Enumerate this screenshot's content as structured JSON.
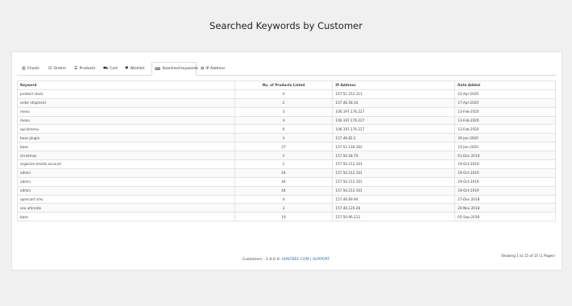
{
  "title": "Searched Keywords by Customer",
  "tabs": [
    {
      "label": "Charts",
      "icon": "bar-chart-icon",
      "glyph": "▥"
    },
    {
      "label": "Orders",
      "icon": "check-square-icon",
      "glyph": "☑"
    },
    {
      "label": "Products",
      "icon": "list-icon",
      "glyph": "☰"
    },
    {
      "label": "Cart",
      "icon": "cart-icon",
      "glyph": "⛟"
    },
    {
      "label": "Wishlist",
      "icon": "heart-icon",
      "glyph": "♥"
    },
    {
      "label": "Searched keywords",
      "icon": "keyboard-icon",
      "glyph": "⌨"
    },
    {
      "label": "IP Address",
      "icon": "globe-icon",
      "glyph": "◍"
    }
  ],
  "table": {
    "headers": [
      "Keyword",
      "No. of Products Listed",
      "IP Address",
      "Date Added"
    ],
    "rows": [
      [
        "product stock",
        "4",
        "157.51.252.111",
        "22-Apr-2020"
      ],
      [
        "order shipment",
        "2",
        "157.46.58.34",
        "17-Apr-2020"
      ],
      [
        "menu",
        "3",
        "106.197.176.227",
        "13-Feb-2020"
      ],
      [
        "menu",
        "3",
        "106.197.176.227",
        "13-Feb-2020"
      ],
      [
        "quickmenu",
        "0",
        "106.197.176.227",
        "13-Feb-2020"
      ],
      [
        "base plugin",
        "3",
        "157.46.82.2",
        "30-Jan-2020"
      ],
      [
        "base",
        "27",
        "157.51.130.162",
        "15-Jan-2020"
      ],
      [
        "christmas",
        "1",
        "157.50.28.70",
        "01-Dec-2019"
      ],
      [
        "organize emails account",
        "1",
        "157.50.212.101",
        "19-Oct-2019"
      ],
      [
        "admin",
        "44",
        "157.50.212.101",
        "19-Oct-2019"
      ],
      [
        "admin",
        "44",
        "157.50.212.101",
        "19-Oct-2019"
      ],
      [
        "admin",
        "44",
        "157.50.212.101",
        "19-Oct-2019"
      ],
      [
        "opencart sms",
        "4",
        "157.46.69.94",
        "27-Dec-2018"
      ],
      [
        "seo ultimate",
        "3",
        "157.46.120.28",
        "20-Nov-2018"
      ],
      [
        "base",
        "19",
        "157.50.96.212",
        "05-Sep-2018"
      ]
    ]
  },
  "pagination_text": "Showing 1 to 15 of 15 (1 Pages)",
  "footer": {
    "prefix": "Customers - 1.0.0 ©",
    "brand_link": "HUNTBEE.COM",
    "separator": "|",
    "support_link": "SUPPORT"
  }
}
